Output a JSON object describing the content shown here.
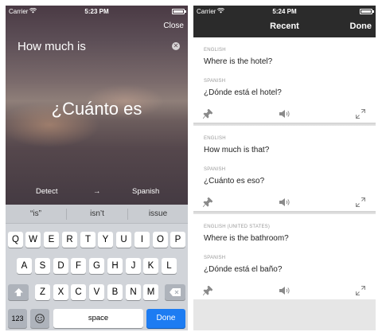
{
  "left": {
    "status": {
      "carrier": "Carrier",
      "time": "5:23 PM"
    },
    "close_label": "Close",
    "input_text": "How much is",
    "translation": "¿Cuánto es",
    "source_language": "Detect",
    "arrow": "→",
    "target_language": "Spanish",
    "suggestions": [
      "“is”",
      "isn’t",
      "issue"
    ],
    "keyboard": {
      "row1": [
        "Q",
        "W",
        "E",
        "R",
        "T",
        "Y",
        "U",
        "I",
        "O",
        "P"
      ],
      "row2": [
        "A",
        "S",
        "D",
        "F",
        "G",
        "H",
        "J",
        "K",
        "L"
      ],
      "row3": [
        "Z",
        "X",
        "C",
        "V",
        "B",
        "N",
        "M"
      ],
      "numbers_label": "123",
      "space_label": "space",
      "done_label": "Done"
    }
  },
  "right": {
    "status": {
      "carrier": "Carrier",
      "time": "5:24 PM"
    },
    "title": "Recent",
    "done_label": "Done",
    "entries": [
      {
        "source_label": "ENGLISH",
        "source_text": "Where is the hotel?",
        "target_label": "SPANISH",
        "target_text": "¿Dónde está el hotel?"
      },
      {
        "source_label": "ENGLISH",
        "source_text": "How much is that?",
        "target_label": "SPANISH",
        "target_text": "¿Cuánto es eso?"
      },
      {
        "source_label": "ENGLISH (UNITED STATES)",
        "source_text": "Where is the bathroom?",
        "target_label": "SPANISH",
        "target_text": "¿Dónde está el baño?"
      }
    ]
  },
  "colors": {
    "done_key": "#1d7cf2",
    "nav_bar": "#2b2b2b",
    "keyboard_bg": "#d1d4d9"
  }
}
